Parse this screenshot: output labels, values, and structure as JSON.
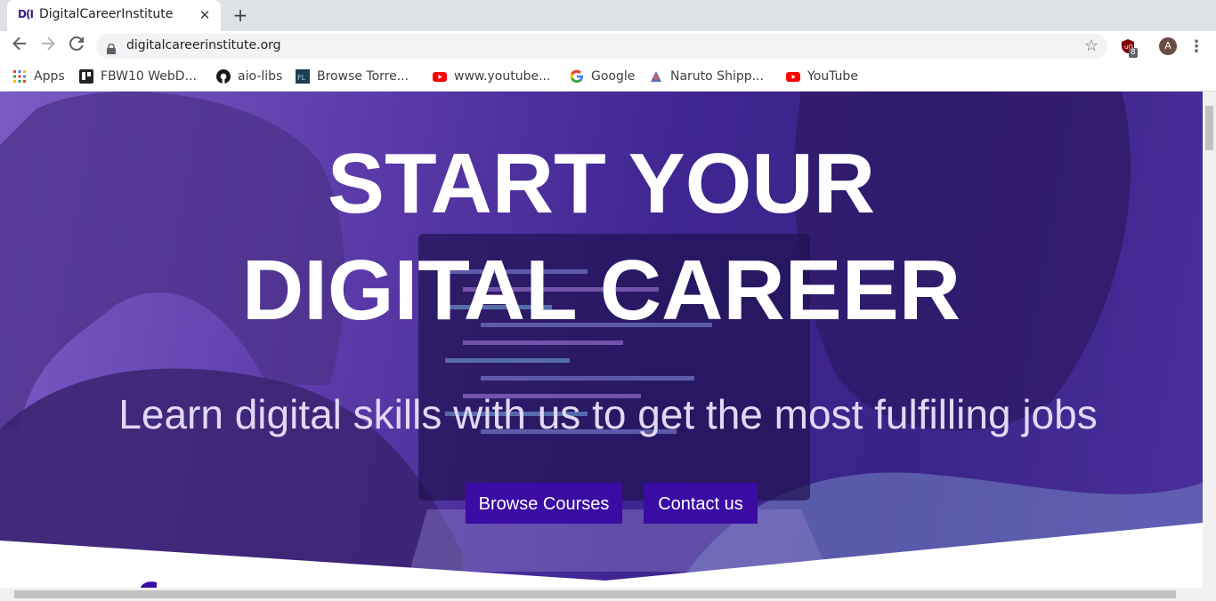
{
  "browser": {
    "tab": {
      "title": "DigitalCareerInstitute",
      "favicon_text": "D(I",
      "close_label": "✕"
    },
    "new_tab_label": "+",
    "url": "digitalcareerinstitute.org",
    "extension_badge": "8",
    "avatar_letter": "A",
    "bookmarks": [
      {
        "label": "Apps",
        "icon": "apps-grid-icon"
      },
      {
        "label": "FBW10 WebD...",
        "icon": "trello-icon"
      },
      {
        "label": "aio-libs",
        "icon": "github-icon"
      },
      {
        "label": "Browse Torre...",
        "icon": "fl-icon"
      },
      {
        "label": "www.youtube...",
        "icon": "youtube-icon"
      },
      {
        "label": "Google",
        "icon": "google-icon"
      },
      {
        "label": "Naruto Shipp...",
        "icon": "naruto-icon"
      },
      {
        "label": "YouTube",
        "icon": "youtube-icon"
      }
    ]
  },
  "hero": {
    "title_line1": "START YOUR",
    "title_line2": "DIGITAL CAREER",
    "subtitle": "Learn digital skills with us to get the most fulfilling jobs",
    "browse_button": "Browse Courses",
    "contact_button": "Contact us"
  },
  "colors": {
    "accent": "#3a0ca3",
    "hero_overlay": "#3e2590"
  }
}
